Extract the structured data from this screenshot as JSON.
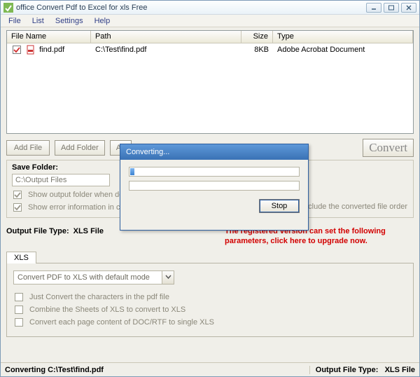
{
  "window": {
    "title": "office Convert Pdf to Excel for xls Free"
  },
  "menu": {
    "file": "File",
    "list": "List",
    "settings": "Settings",
    "help": "Help"
  },
  "grid": {
    "cols": {
      "name": "File Name",
      "path": "Path",
      "size": "Size",
      "type": "Type"
    },
    "rows": [
      {
        "checked": true,
        "name": "find.pdf",
        "path": "C:\\Test\\find.pdf",
        "size": "8KB",
        "type": "Adobe Acrobat Document"
      }
    ]
  },
  "toolbar": {
    "add_file": "Add File",
    "add_folder": "Add Folder",
    "add_truncated": "Ad",
    "convert": "Convert"
  },
  "save": {
    "label": "Save Folder:",
    "path": "C:\\Output Files",
    "show_folder": "Show output folder when done",
    "show_error": "Show error information in convers",
    "include_order": "Include the converted file order"
  },
  "output": {
    "label": "Output File Type:",
    "value": "XLS File"
  },
  "upgrade": "The registered version can set the following parameters, click here to upgrade now.",
  "tab": {
    "label": "XLS"
  },
  "combo": {
    "selected": "Convert PDF to XLS with default mode"
  },
  "options": {
    "just_chars": "Just Convert the characters in the pdf file",
    "combine": "Combine the Sheets of XLS to convert to XLS",
    "each_page": "Convert each page content of DOC/RTF to single XLS"
  },
  "status": {
    "left": "Converting  C:\\Test\\find.pdf",
    "right_label": "Output File Type:",
    "right_value": "XLS File"
  },
  "modal": {
    "title": "Converting...",
    "stop": "Stop"
  }
}
